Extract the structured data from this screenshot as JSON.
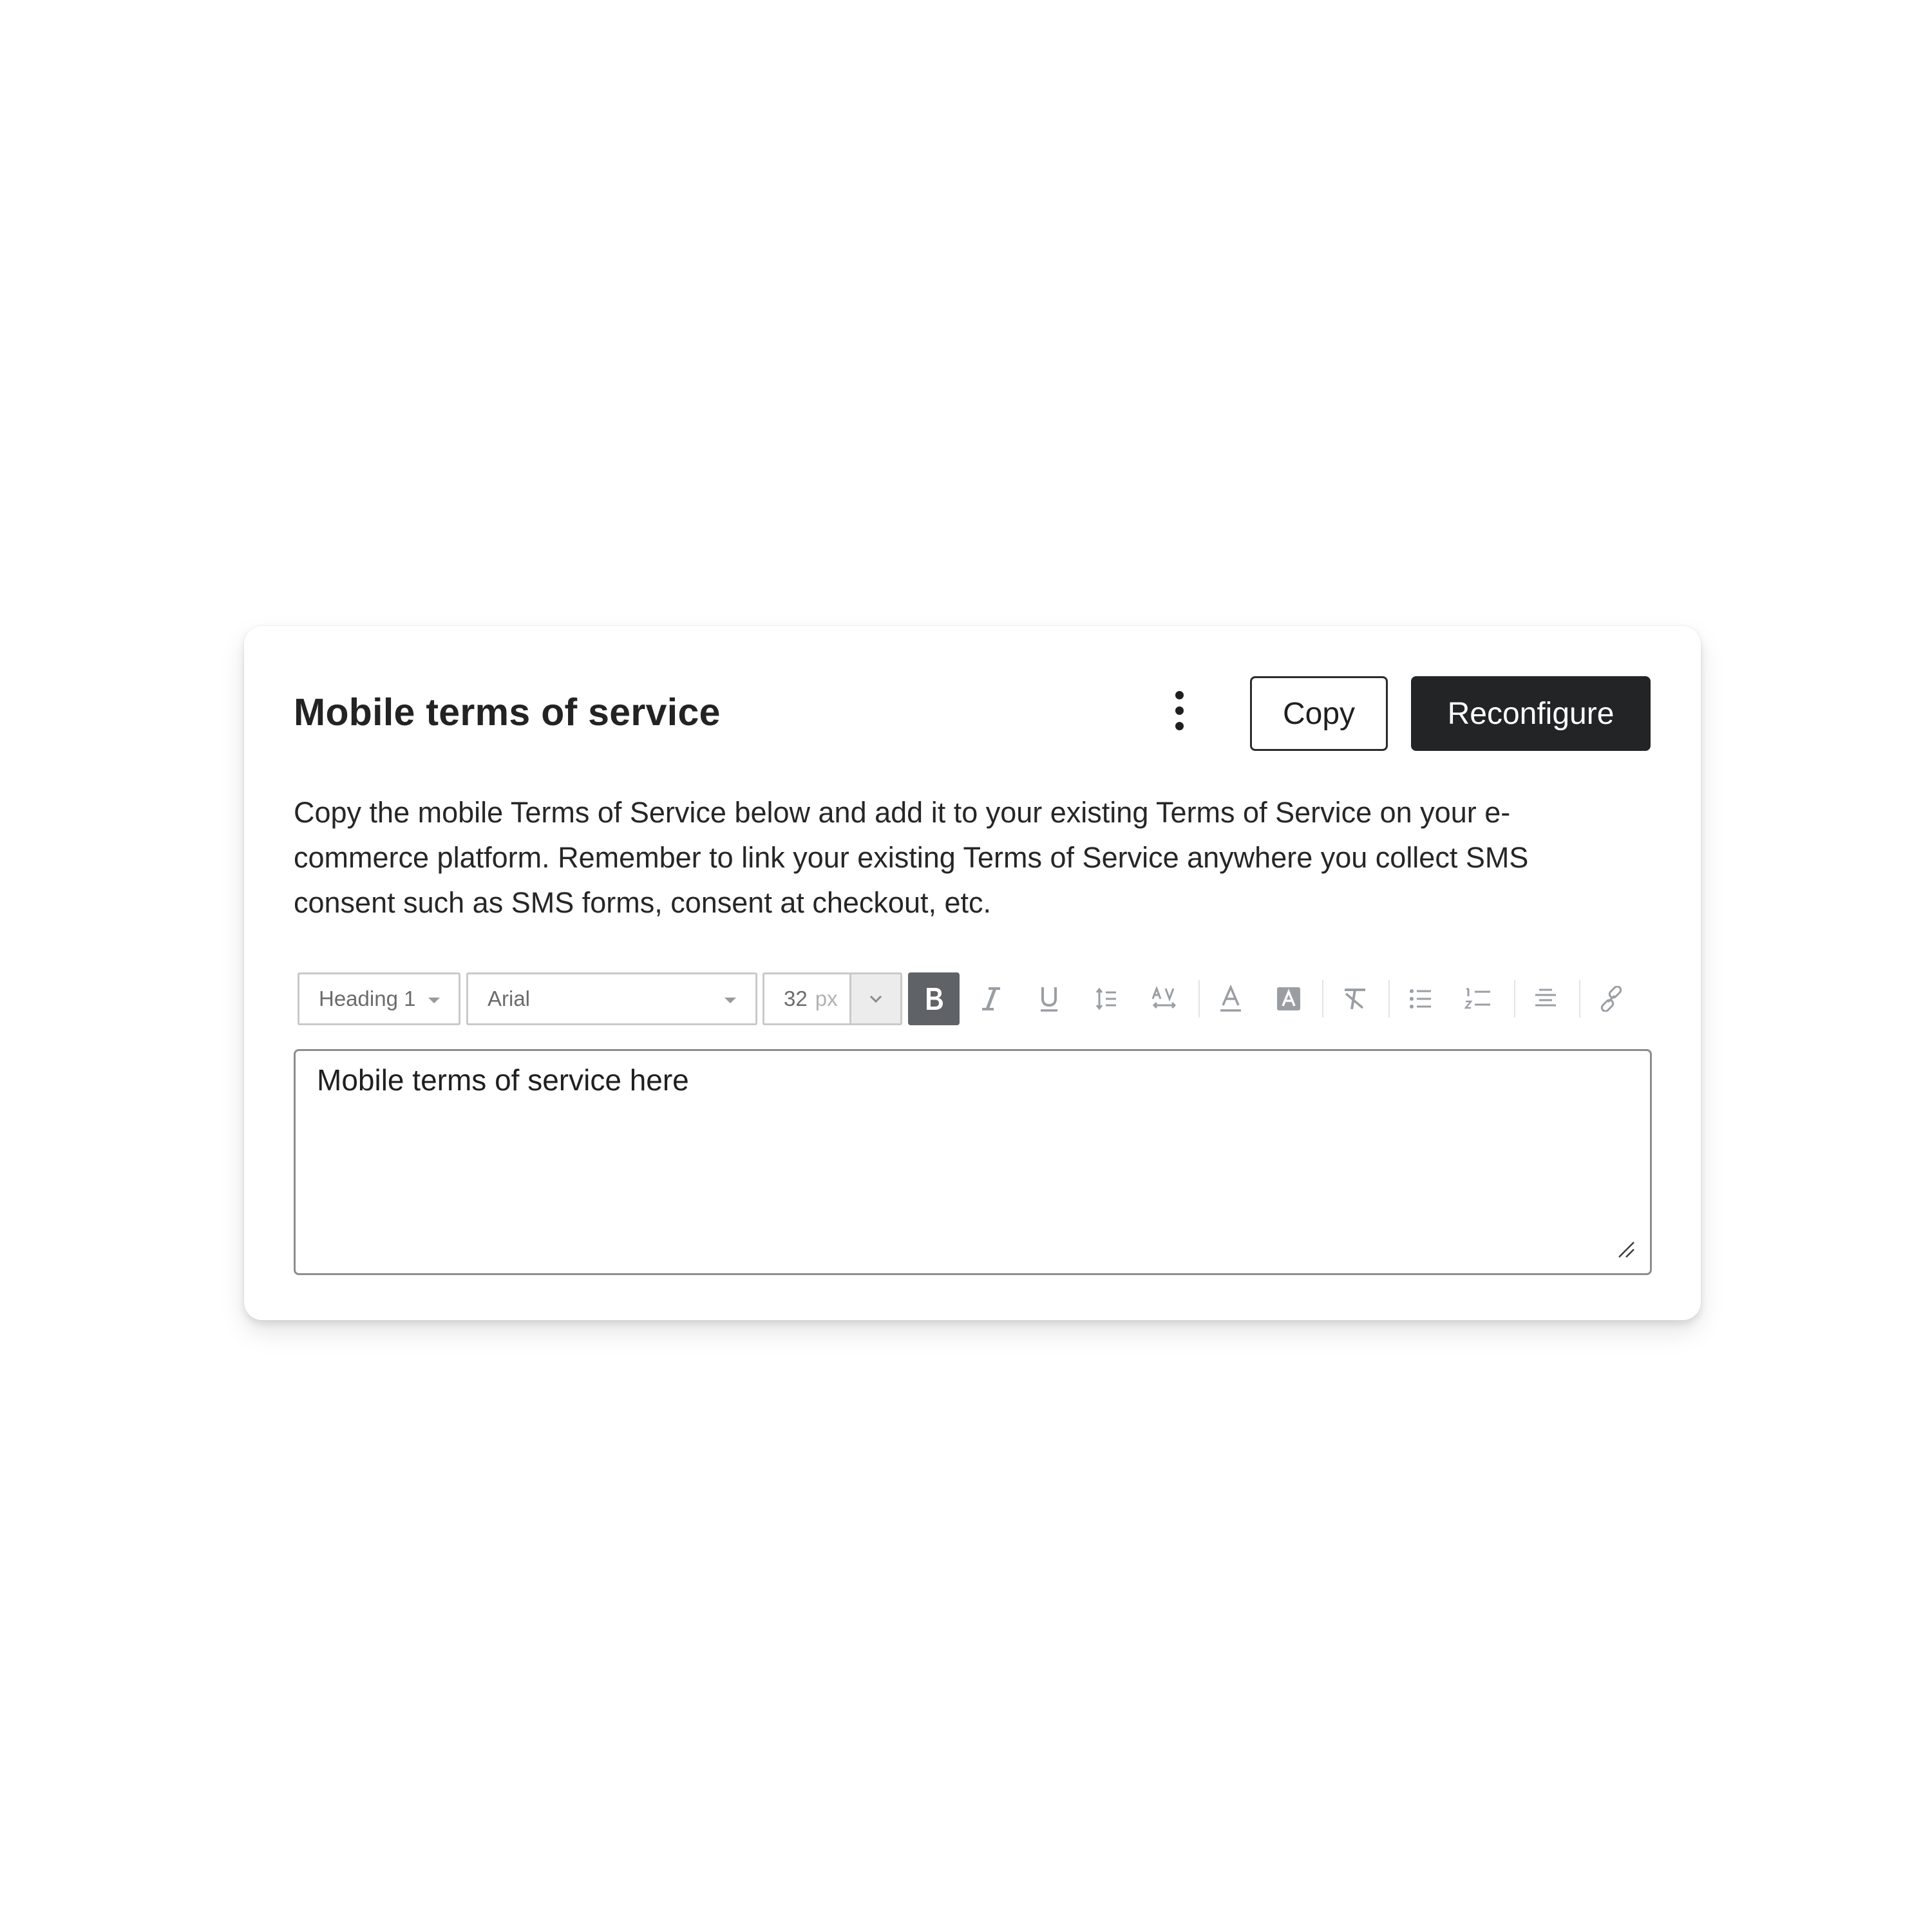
{
  "card": {
    "title": "Mobile terms of service",
    "more_icon": "more-vertical-icon",
    "copy_label": "Copy",
    "reconfigure_label": "Reconfigure",
    "description": "Copy the mobile Terms of Service below and add it to your existing Terms of Service on your e-commerce platform. Remember to link your existing Terms of Service anywhere you collect SMS consent such as SMS forms, consent at checkout, etc."
  },
  "toolbar": {
    "block_style": "Heading 1",
    "font_family": "Arial",
    "font_size": "32",
    "font_size_unit": "px",
    "buttons": [
      {
        "icon": "bold-icon",
        "active": true
      },
      {
        "icon": "italic-icon",
        "active": false
      },
      {
        "icon": "underline-icon",
        "active": false
      },
      {
        "icon": "line-height-icon",
        "active": false
      },
      {
        "icon": "letter-spacing-icon",
        "active": false
      },
      {
        "icon": "text-color-icon",
        "active": false
      },
      {
        "icon": "highlight-color-icon",
        "active": false
      },
      {
        "icon": "clear-formatting-icon",
        "active": false
      },
      {
        "icon": "bulleted-list-icon",
        "active": false
      },
      {
        "icon": "numbered-list-icon",
        "active": false
      },
      {
        "icon": "align-center-icon",
        "active": false
      },
      {
        "icon": "link-icon",
        "active": false
      }
    ]
  },
  "editor": {
    "content": "Mobile terms of service here"
  },
  "colors": {
    "primary_button": "#232426",
    "active_tool": "#5f6368",
    "tool_icon": "#9a9ea3"
  }
}
